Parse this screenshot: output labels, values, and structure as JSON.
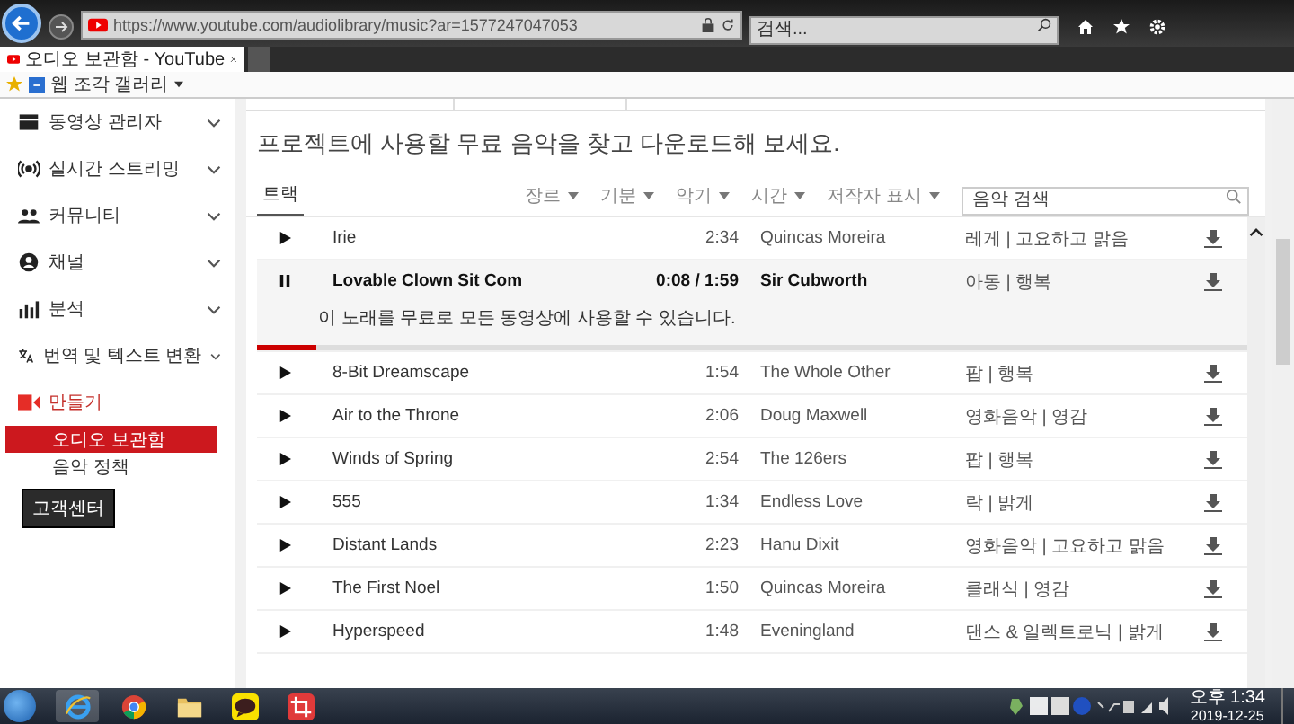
{
  "browser": {
    "url": "https://www.youtube.com/audiolibrary/music?ar=1577247047053",
    "search_placeholder": "검색...",
    "tab_title": "오디오 보관함 - YouTube",
    "favorites": [
      "웹 조각 갤러리"
    ]
  },
  "sidebar": {
    "items": [
      {
        "label": "동영상 관리자",
        "kind": "group",
        "expanded": false
      },
      {
        "label": "실시간 스트리밍",
        "kind": "group",
        "expanded": false
      },
      {
        "label": "커뮤니티",
        "kind": "group",
        "expanded": false
      },
      {
        "label": "채널",
        "kind": "group",
        "expanded": false
      },
      {
        "label": "분석",
        "kind": "group",
        "expanded": false
      },
      {
        "label": "번역 및 텍스트 변환",
        "kind": "group",
        "expanded": false
      },
      {
        "label": "만들기",
        "kind": "section",
        "children": [
          {
            "label": "오디오 보관함",
            "selected": true
          },
          {
            "label": "음악 정책",
            "selected": false
          }
        ]
      }
    ],
    "help_button": "고객센터"
  },
  "main": {
    "heading": "프로젝트에 사용할 무료 음악을 찾고 다운로드해 보세요.",
    "tabs": [
      {
        "label": "트랙",
        "selected": true
      }
    ],
    "filters": [
      "장르",
      "기분",
      "악기",
      "시간",
      "저작자 표시"
    ],
    "search": {
      "placeholder": "음악 검색"
    },
    "tracks": [
      {
        "title": "Irie",
        "duration": "2:34",
        "artist": "Quincas Moreira",
        "genre": "레게 | 고요하고 맑음",
        "playing": false
      },
      {
        "title": "Lovable Clown Sit Com",
        "duration": "0:08 / 1:59",
        "artist": "Sir Cubworth",
        "genre": "아동 | 행복",
        "playing": true,
        "description": "이 노래를 무료로 모든 동영상에 사용할 수 있습니다.",
        "level": 0.06
      },
      {
        "title": "8-Bit Dreamscape",
        "duration": "1:54",
        "artist": "The Whole Other",
        "genre": "팝 | 행복",
        "playing": false
      },
      {
        "title": "Air to the Throne",
        "duration": "2:06",
        "artist": "Doug Maxwell",
        "genre": "영화음악 | 영감",
        "playing": false
      },
      {
        "title": "Winds of Spring",
        "duration": "2:54",
        "artist": "The 126ers",
        "genre": "팝 | 행복",
        "playing": false
      },
      {
        "title": "555",
        "duration": "1:34",
        "artist": "Endless Love",
        "genre": "락 | 밝게",
        "playing": false
      },
      {
        "title": "Distant Lands",
        "duration": "2:23",
        "artist": "Hanu Dixit",
        "genre": "영화음악 | 고요하고 맑음",
        "playing": false
      },
      {
        "title": "The First Noel",
        "duration": "1:50",
        "artist": "Quincas Moreira",
        "genre": "클래식 | 영감",
        "playing": false
      },
      {
        "title": "Hyperspeed",
        "duration": "1:48",
        "artist": "Eveningland",
        "genre": "댄스 & 일렉트로닉 | 밝게",
        "playing": false
      }
    ]
  },
  "taskbar": {
    "time": "오후 1:34",
    "date": "2019-12-25"
  }
}
